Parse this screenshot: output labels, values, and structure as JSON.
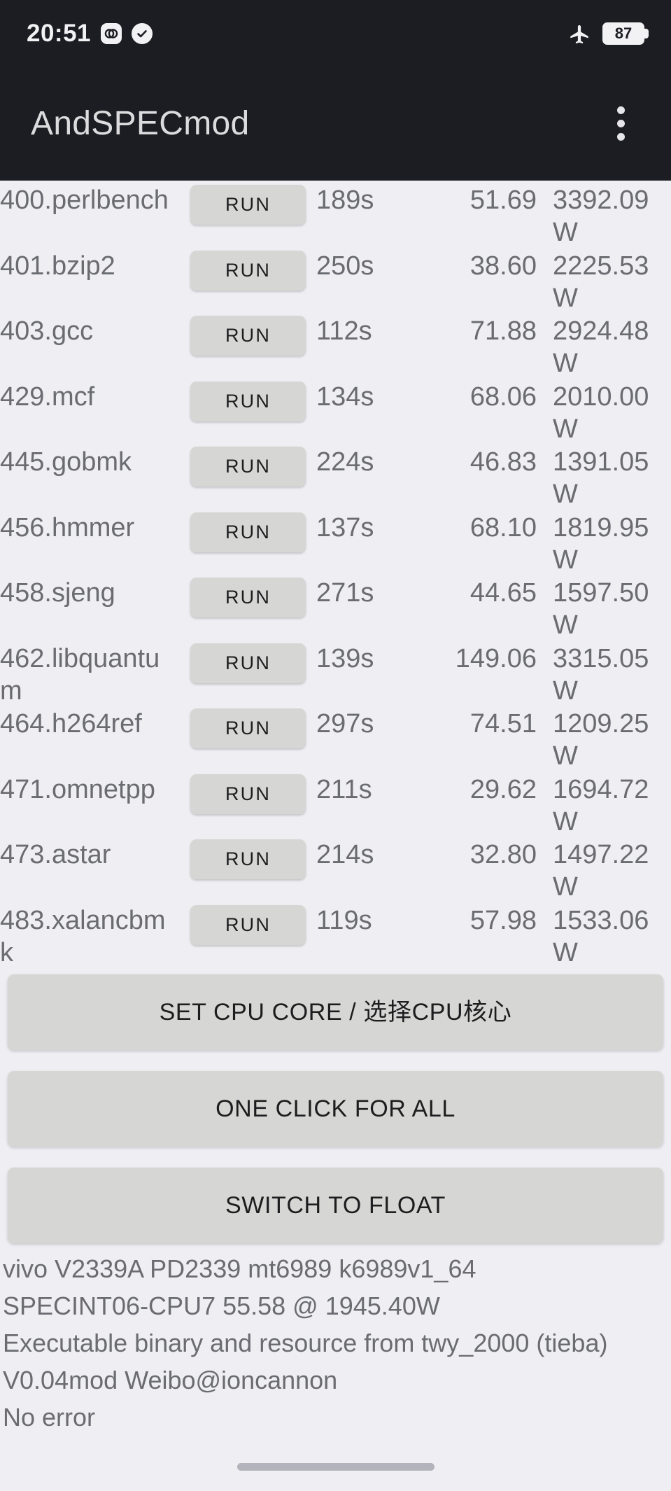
{
  "statusbar": {
    "clock": "20:51",
    "battery_level": "87",
    "icons": [
      "app-dual-circle-icon",
      "check-circle-icon",
      "airplane-mode-icon",
      "battery-icon"
    ]
  },
  "appbar": {
    "title": "AndSPECmod",
    "overflow_icon": "more-vertical-icon"
  },
  "benchmarks": {
    "run_label": "RUN",
    "rows": [
      {
        "name": "400.perlbench",
        "time": "189s",
        "score": "51.69",
        "power": "3392.09 W"
      },
      {
        "name": "401.bzip2",
        "time": "250s",
        "score": "38.60",
        "power": "2225.53 W"
      },
      {
        "name": "403.gcc",
        "time": "112s",
        "score": "71.88",
        "power": "2924.48 W"
      },
      {
        "name": "429.mcf",
        "time": "134s",
        "score": "68.06",
        "power": "2010.00 W"
      },
      {
        "name": "445.gobmk",
        "time": "224s",
        "score": "46.83",
        "power": "1391.05 W"
      },
      {
        "name": "456.hmmer",
        "time": "137s",
        "score": "68.10",
        "power": "1819.95 W"
      },
      {
        "name": "458.sjeng",
        "time": "271s",
        "score": "44.65",
        "power": "1597.50 W"
      },
      {
        "name": "462.libquantum",
        "time": "139s",
        "score": "149.06",
        "power": "3315.05 W"
      },
      {
        "name": "464.h264ref",
        "time": "297s",
        "score": "74.51",
        "power": "1209.25 W"
      },
      {
        "name": "471.omnetpp",
        "time": "211s",
        "score": "29.62",
        "power": "1694.72 W"
      },
      {
        "name": "473.astar",
        "time": "214s",
        "score": "32.80",
        "power": "1497.22 W"
      },
      {
        "name": "483.xalancbmk",
        "time": "119s",
        "score": "57.98",
        "power": "1533.06 W"
      }
    ]
  },
  "actions": [
    {
      "label": "SET CPU CORE / 选择CPU核心"
    },
    {
      "label": "ONE CLICK FOR ALL"
    },
    {
      "label": "SWITCH TO FLOAT"
    }
  ],
  "info": {
    "line1": "vivo V2339A PD2339 mt6989 k6989v1_64",
    "line2": "SPECINT06-CPU7  55.58 @ 1945.40W",
    "line3": "Executable binary and resource from twy_2000 (tieba)",
    "line4": "V0.04mod  Weibo@ioncannon",
    "line5": "No error"
  },
  "colors": {
    "appbar_bg": "#1c1d22",
    "page_bg": "#eeeef3",
    "button_bg": "#d6d7d4",
    "text_muted": "#6b6c72",
    "text_dark": "#1d1d1f"
  }
}
